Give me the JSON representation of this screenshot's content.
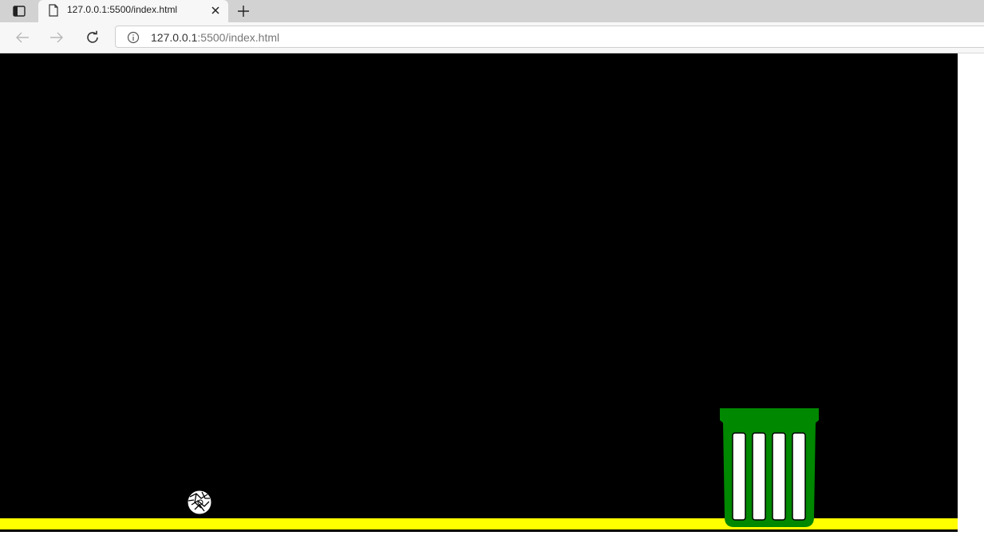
{
  "tab": {
    "title": "127.0.0.1:5500/index.html"
  },
  "address_bar": {
    "url_host": "127.0.0.1",
    "url_rest": ":5500/index.html"
  },
  "icons": {
    "tab_switcher": "tab-switcher-icon",
    "tab_file": "file-icon",
    "tab_close": "close-icon",
    "new_tab": "plus-icon",
    "back": "arrow-left-icon",
    "forward": "arrow-right-icon",
    "reload": "reload-icon",
    "site_info": "info-icon"
  },
  "game": {
    "background_color": "#000000",
    "ground_color": "#ffff00",
    "bin_color": "#008800",
    "ball_color": "#ffffff"
  }
}
